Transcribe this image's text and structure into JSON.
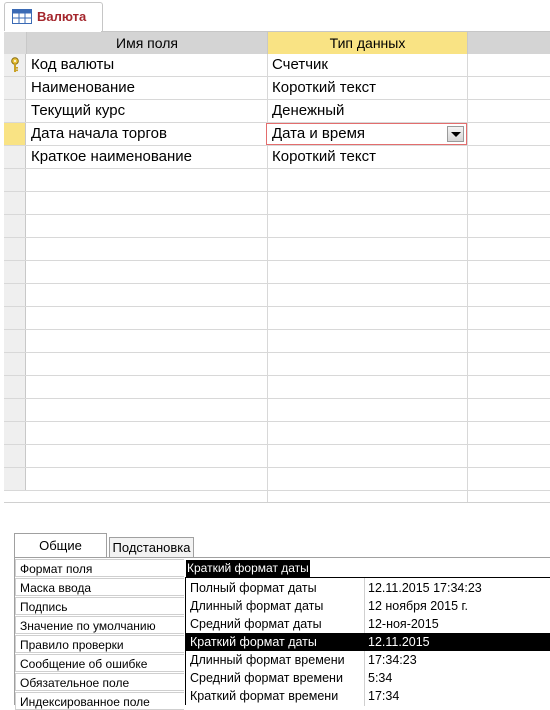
{
  "tab": {
    "title": "Валюта"
  },
  "grid": {
    "headers": [
      "Имя поля",
      "Тип данных"
    ],
    "rows": [
      {
        "name": "Код валюты",
        "type": "Счетчик"
      },
      {
        "name": "Наименование",
        "type": "Короткий текст"
      },
      {
        "name": "Текущий курс",
        "type": "Денежный"
      },
      {
        "name": "Дата начала торгов",
        "type": "Дата и время"
      },
      {
        "name": "Краткое наименование",
        "type": "Короткий текст"
      }
    ]
  },
  "props": {
    "tabs": [
      "Общие",
      "Подстановка"
    ],
    "labels": [
      "Формат поля",
      "Маска ввода",
      "Подпись",
      "Значение по умолчанию",
      "Правило проверки",
      "Сообщение об ошибке",
      "Обязательное поле",
      "Индексированное поле"
    ],
    "format_value": "Краткий формат даты"
  },
  "dropdown": {
    "options": [
      {
        "name": "Полный формат даты",
        "example": "12.11.2015 17:34:23"
      },
      {
        "name": "Длинный формат даты",
        "example": "12 ноября 2015 г."
      },
      {
        "name": "Средний формат даты",
        "example": "12-ноя-2015"
      },
      {
        "name": "Краткий формат даты",
        "example": "12.11.2015"
      },
      {
        "name": "Длинный формат времени",
        "example": "17:34:23"
      },
      {
        "name": "Средний формат времени",
        "example": "5:34"
      },
      {
        "name": "Краткий формат времени",
        "example": "17:34"
      }
    ]
  },
  "colors": {
    "header_active": "#f9e384",
    "tab_title": "#a4262c",
    "selected_bg": "#000000"
  }
}
